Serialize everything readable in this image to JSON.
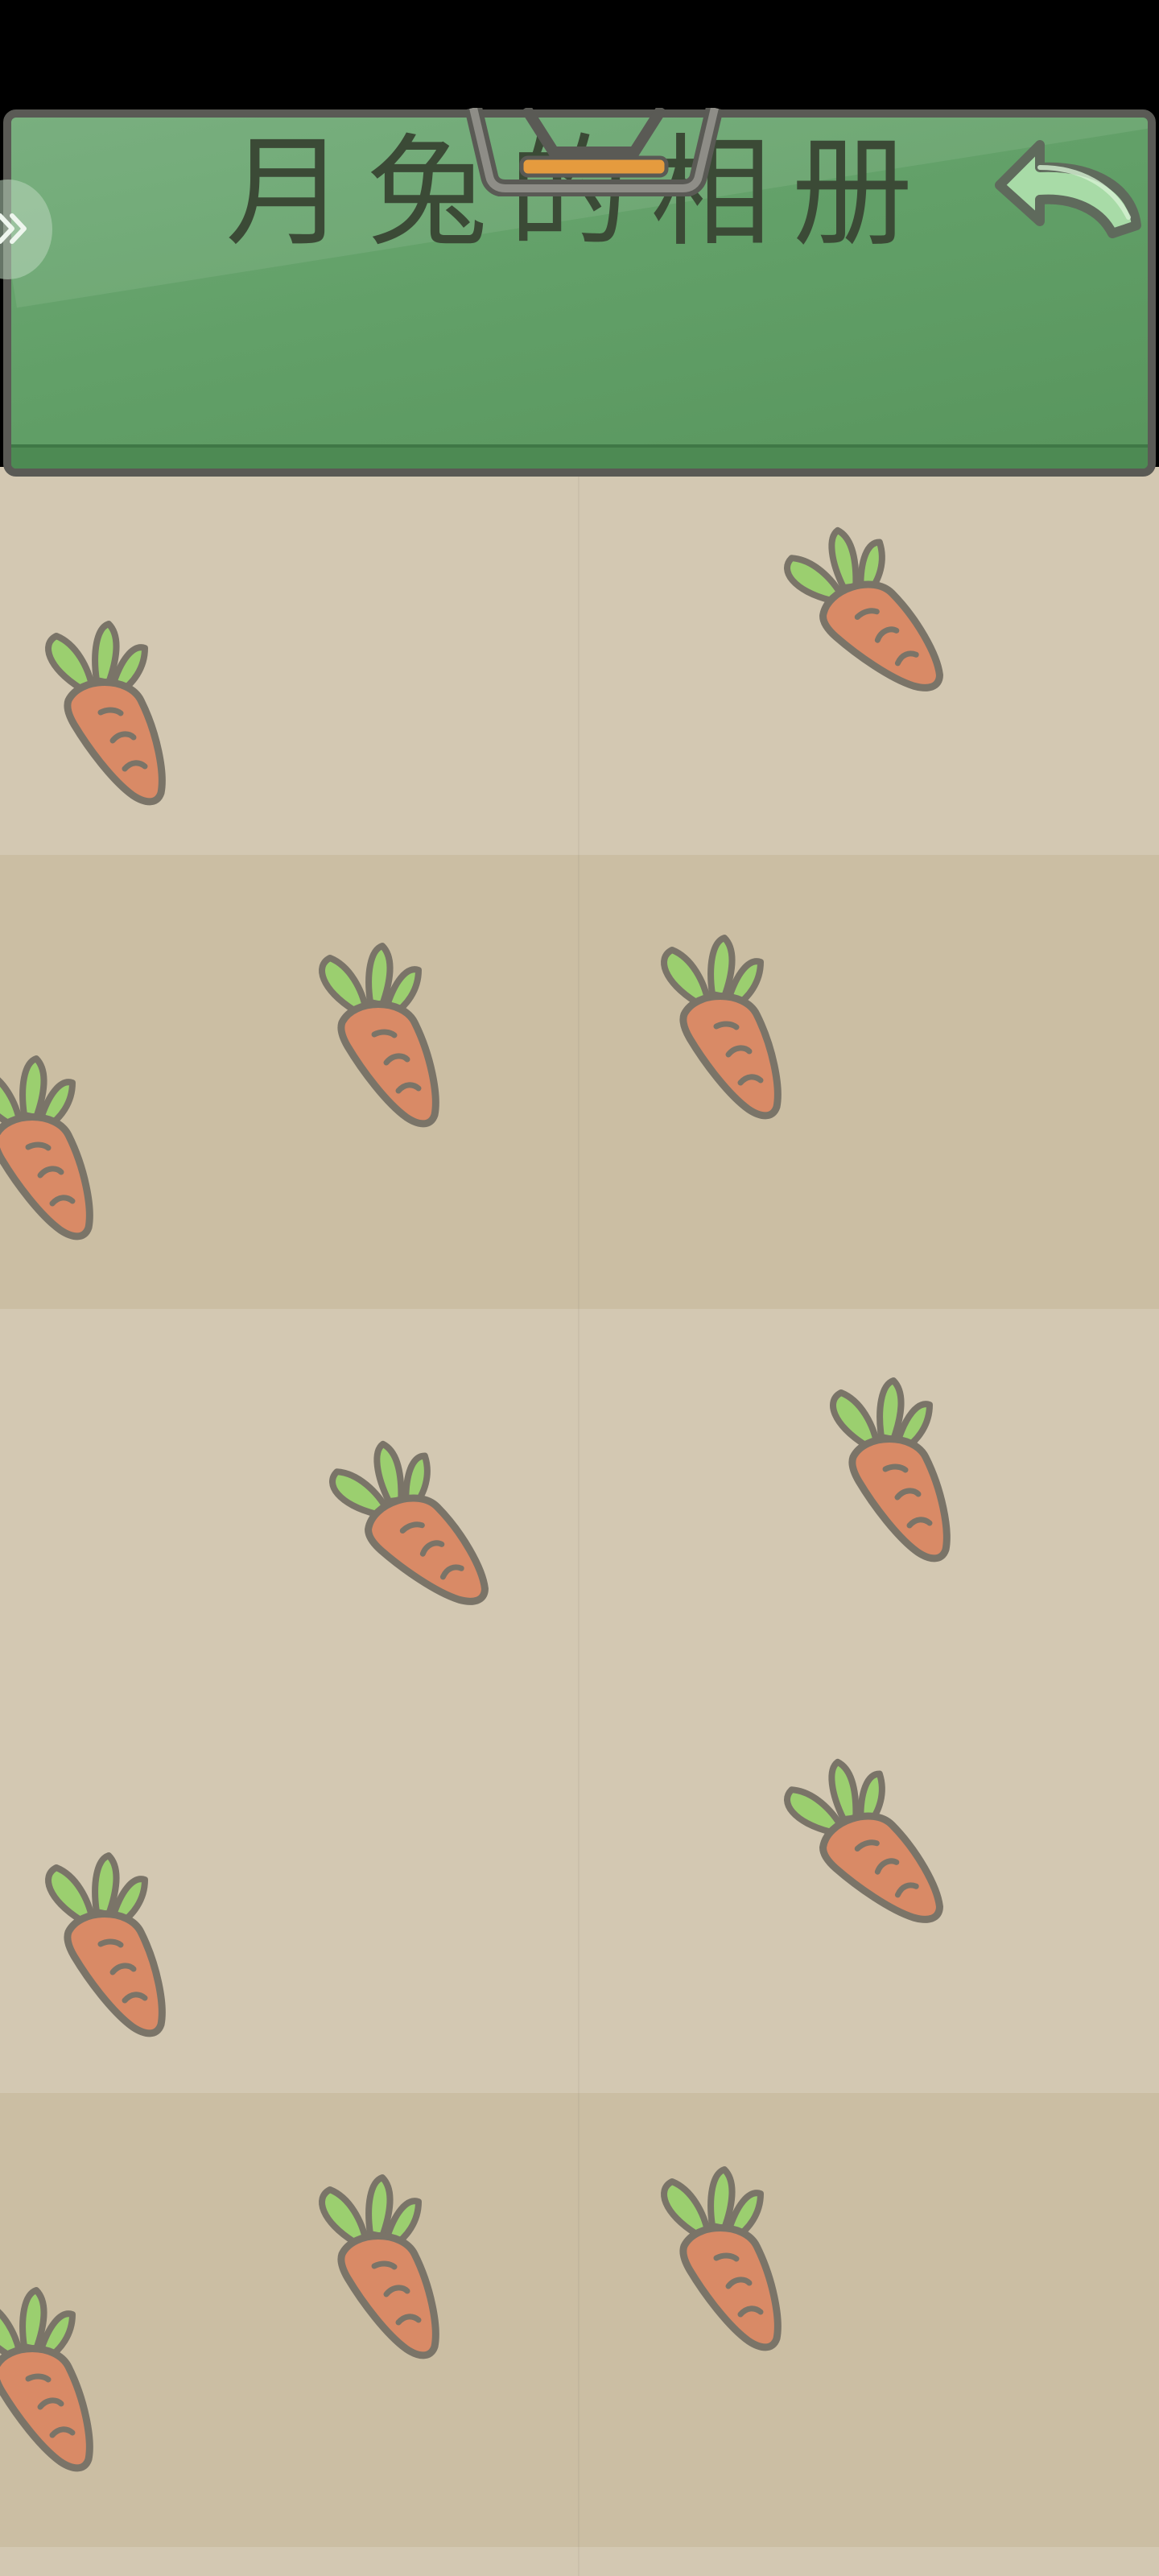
{
  "header": {
    "title": "月兔的相册"
  },
  "icons": {
    "back": "back-arrow-icon",
    "side_tab": "double-chevron-right-icon",
    "carrot": "carrot-icon",
    "handle": "hanger-bracket-icon"
  },
  "colors": {
    "header_green": "#62a068",
    "board_light": "#d3c8b2",
    "board_dark": "#cbbea3",
    "carrot_orange": "#d98a66",
    "carrot_leaf": "#9bcf6f",
    "outline_gray": "#7a7468"
  }
}
